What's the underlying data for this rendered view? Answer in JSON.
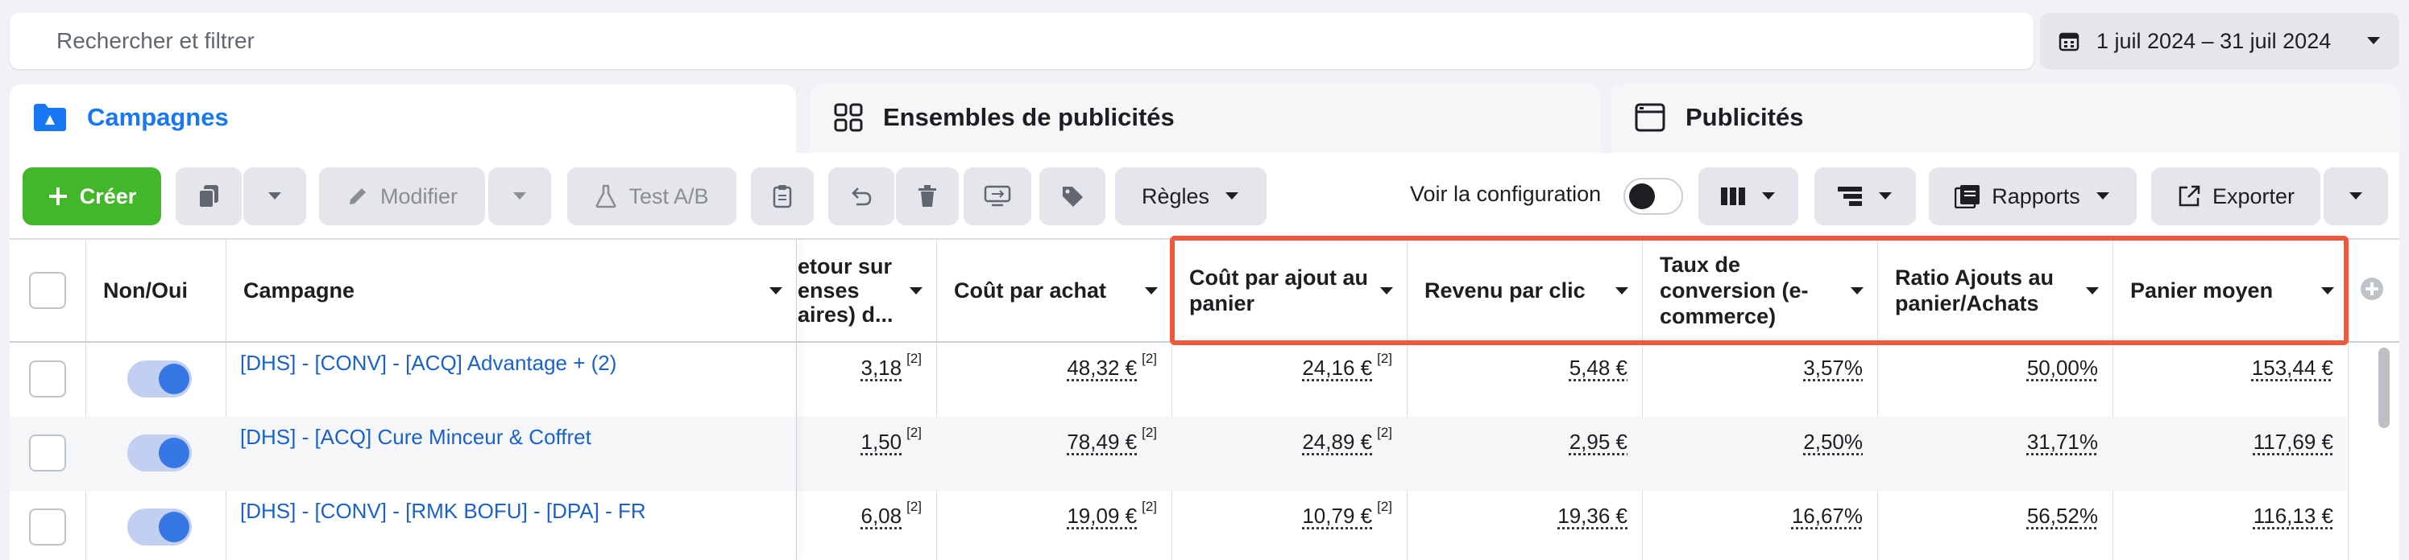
{
  "search": {
    "placeholder": "Rechercher et filtrer"
  },
  "date_range": {
    "label": "1 juil 2024 – 31 juil 2024"
  },
  "level_tabs": [
    {
      "label": "Campagnes",
      "active": true
    },
    {
      "label": "Ensembles de publicités",
      "active": false
    },
    {
      "label": "Publicités",
      "active": false
    }
  ],
  "toolbar": {
    "create_label": "Créer",
    "edit_label": "Modifier",
    "ab_test_label": "Test A/B",
    "rules_label": "Règles",
    "view_config_label": "Voir la configuration",
    "reports_label": "Rapports",
    "export_label": "Exporter"
  },
  "table": {
    "columns": [
      {
        "key": "toggle",
        "label": "Non/Oui"
      },
      {
        "key": "campaign",
        "label": "Campagne"
      },
      {
        "key": "roas",
        "label": "Retour sur dépenses publicitaires) d..."
      },
      {
        "key": "cpa",
        "label": "Coût par achat"
      },
      {
        "key": "cost_atc",
        "label": "Coût par ajout au panier"
      },
      {
        "key": "rev_click",
        "label": "Revenu par clic"
      },
      {
        "key": "conv_rate",
        "label": "Taux de conversion (e-commerce)"
      },
      {
        "key": "atc_ratio",
        "label": "Ratio Ajouts au panier/Achats"
      },
      {
        "key": "aov",
        "label": "Panier moyen"
      }
    ],
    "header_parts": {
      "roas_l1": "etour sur",
      "roas_l2": "enses",
      "roas_l3": "aires) d..."
    },
    "rows": [
      {
        "campaign": "[DHS] - [CONV] - [ACQ] Advantage + (2)",
        "roas": "3,18",
        "roas_note": "[2]",
        "cpa": "48,32 €",
        "cpa_note": "[2]",
        "cost_atc": "24,16 €",
        "cost_atc_note": "[2]",
        "rev_click": "5,48 €",
        "conv_rate": "3,57%",
        "atc_ratio": "50,00%",
        "aov": "153,44 €"
      },
      {
        "campaign": "[DHS] - [ACQ] Cure Minceur & Coffret",
        "roas": "1,50",
        "roas_note": "[2]",
        "cpa": "78,49 €",
        "cpa_note": "[2]",
        "cost_atc": "24,89 €",
        "cost_atc_note": "[2]",
        "rev_click": "2,95 €",
        "conv_rate": "2,50%",
        "atc_ratio": "31,71%",
        "aov": "117,69 €"
      },
      {
        "campaign": "[DHS] - [CONV] - [RMK BOFU] - [DPA] - FR",
        "roas": "6,08",
        "roas_note": "[2]",
        "cpa": "19,09 €",
        "cpa_note": "[2]",
        "cost_atc": "10,79 €",
        "cost_atc_note": "[2]",
        "rev_click": "19,36 €",
        "conv_rate": "16,67%",
        "atc_ratio": "56,52%",
        "aov": "116,13 €"
      }
    ]
  },
  "colors": {
    "accent": "#1877f2",
    "create_green": "#42b72a",
    "highlight": "#f0583d",
    "link": "#1a62c7"
  }
}
